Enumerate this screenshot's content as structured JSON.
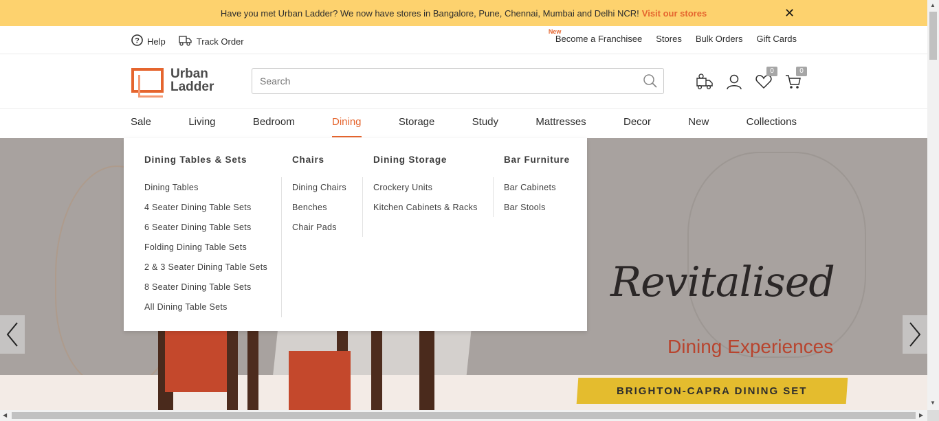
{
  "announcement": {
    "text": "Have you met Urban Ladder? We now have stores in Bangalore, Pune, Chennai, Mumbai and Delhi NCR!",
    "link": "Visit our stores",
    "close": "✕"
  },
  "utility": {
    "left": [
      {
        "label": "Help",
        "icon": "help-icon"
      },
      {
        "label": "Track Order",
        "icon": "truck-icon"
      }
    ],
    "right": {
      "new_tag": "New",
      "franchise": "Become a Franchisee",
      "stores": "Stores",
      "bulk": "Bulk Orders",
      "gift": "Gift Cards"
    }
  },
  "header": {
    "logo_line1": "Urban",
    "logo_line2": "Ladder",
    "search_placeholder": "Search",
    "wishlist_count": "0",
    "cart_count": "0"
  },
  "nav": {
    "items": [
      "Sale",
      "Living",
      "Bedroom",
      "Dining",
      "Storage",
      "Study",
      "Mattresses",
      "Decor",
      "New",
      "Collections"
    ],
    "active": "Dining"
  },
  "mega_menu": {
    "columns": [
      {
        "title": "Dining Tables & Sets",
        "items": [
          "Dining Tables",
          "4 Seater Dining Table Sets",
          "6 Seater Dining Table Sets",
          "Folding Dining Table Sets",
          "2 & 3 Seater Dining Table Sets",
          "8 Seater Dining Table Sets",
          "All Dining Table Sets"
        ]
      },
      {
        "title": "Chairs",
        "items": [
          "Dining Chairs",
          "Benches",
          "Chair Pads"
        ]
      },
      {
        "title": "Dining Storage",
        "items": [
          "Crockery Units",
          "Kitchen Cabinets & Racks"
        ]
      },
      {
        "title": "Bar Furniture",
        "items": [
          "Bar Cabinets",
          "Bar Stools"
        ]
      }
    ]
  },
  "hero": {
    "headline": "Revitalised",
    "subline": "Dining Experiences",
    "banner": "BRIGHTON-CAPRA DINING SET"
  },
  "colors": {
    "accent": "#e5652e",
    "announce_bg": "#fdd26e",
    "banner": "#e4bc2e"
  }
}
